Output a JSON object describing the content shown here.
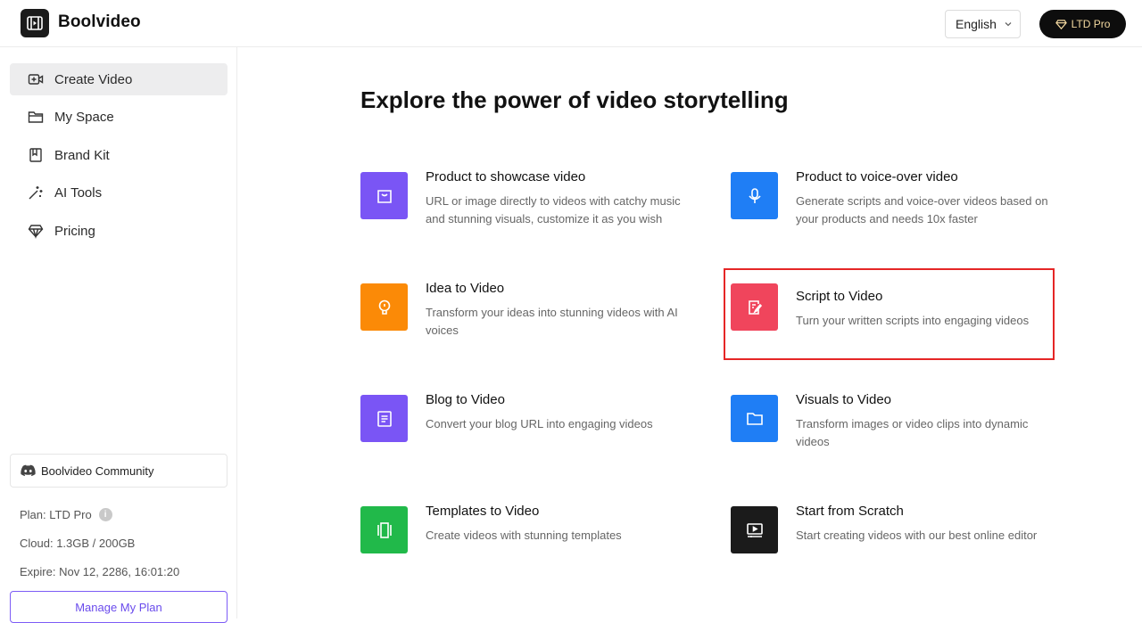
{
  "header": {
    "brand": "Boolvideo",
    "language": "English",
    "plan_button": "LTD Pro"
  },
  "sidebar": {
    "items": [
      {
        "label": "Create Video",
        "icon": "video-plus-icon",
        "active": true
      },
      {
        "label": "My Space",
        "icon": "folder-icon",
        "active": false
      },
      {
        "label": "Brand Kit",
        "icon": "book-icon",
        "active": false
      },
      {
        "label": "AI Tools",
        "icon": "magic-wand-icon",
        "active": false
      },
      {
        "label": "Pricing",
        "icon": "diamond-icon",
        "active": false
      }
    ],
    "community": "Boolvideo Community",
    "plan": "Plan: LTD Pro",
    "cloud": "Cloud: 1.3GB / 200GB",
    "expire": "Expire: Nov 12, 2286, 16:01:20",
    "manage_button": "Manage My Plan"
  },
  "main": {
    "title": "Explore the power of video storytelling",
    "cards": [
      {
        "title": "Product to showcase video",
        "desc": "URL or image directly to videos with catchy music and stunning visuals, customize it as you wish",
        "icon": "shopping-bag-icon",
        "color": "#7a55f5"
      },
      {
        "title": "Product to voice-over video",
        "desc": "Generate scripts and voice-over videos based on your products and needs 10x faster",
        "icon": "microphone-icon",
        "color": "#1f7ef5"
      },
      {
        "title": "Idea to Video",
        "desc": "Transform your ideas into stunning videos with AI voices",
        "icon": "lightbulb-icon",
        "color": "#fb8a07"
      },
      {
        "title": "Script to Video",
        "desc": "Turn your written scripts into engaging videos",
        "icon": "script-edit-icon",
        "color": "#f0455c"
      },
      {
        "title": "Blog to Video",
        "desc": "Convert your blog URL into engaging videos",
        "icon": "document-icon",
        "color": "#7a55f5"
      },
      {
        "title": "Visuals to Video",
        "desc": "Transform images or video clips into dynamic videos",
        "icon": "folder-icon",
        "color": "#1f7ef5"
      },
      {
        "title": "Templates to Video",
        "desc": "Create videos with stunning templates",
        "icon": "templates-icon",
        "color": "#21b94a"
      },
      {
        "title": "Start from Scratch",
        "desc": "Start creating videos with our best online editor",
        "icon": "editor-screen-icon",
        "color": "#1b1b1b"
      }
    ]
  }
}
